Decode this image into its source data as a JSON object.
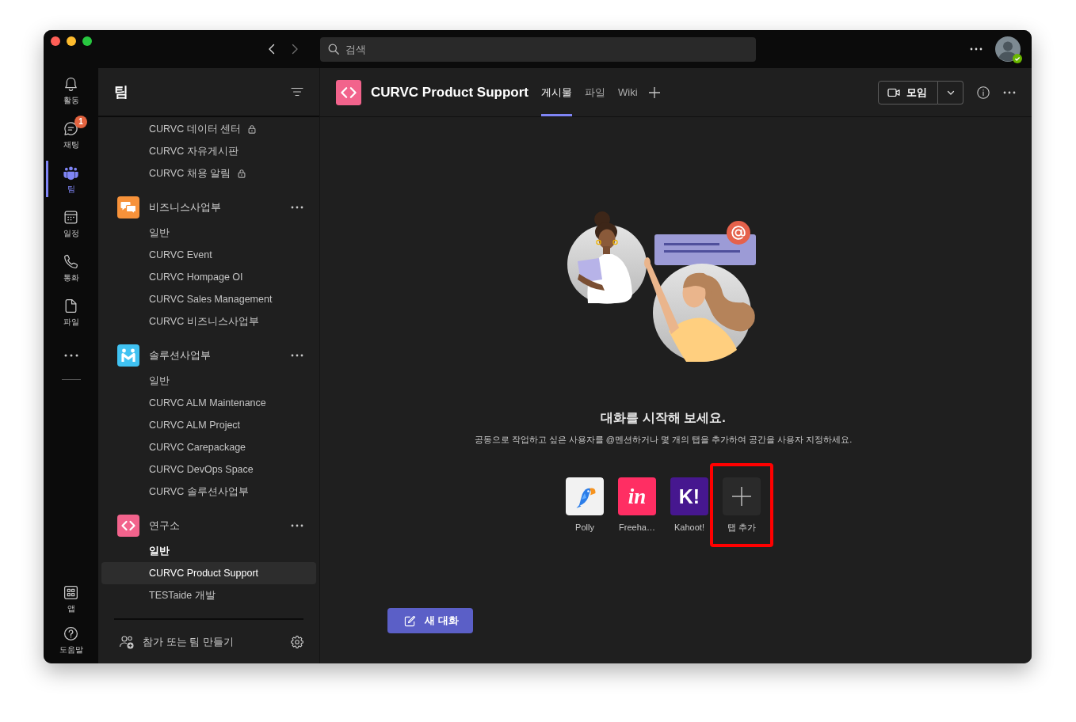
{
  "title_bar": {
    "back": {
      "disabled": false
    },
    "forward": {
      "disabled": true
    },
    "search": {
      "placeholder": "검색"
    }
  },
  "app_bar": {
    "items": [
      {
        "kind": "activity",
        "label": "활동",
        "selected": false
      },
      {
        "kind": "chat",
        "label": "채팅",
        "selected": false,
        "badge": "1"
      },
      {
        "kind": "teams",
        "label": "팀",
        "selected": true
      },
      {
        "kind": "calendar",
        "label": "일정",
        "selected": false
      },
      {
        "kind": "calls",
        "label": "통화",
        "selected": false
      },
      {
        "kind": "files",
        "label": "파일",
        "selected": false
      }
    ],
    "bottom_items": [
      {
        "kind": "apps",
        "label": "앱",
        "selected": false
      },
      {
        "kind": "help",
        "label": "도움말",
        "selected": false
      }
    ]
  },
  "sidebar": {
    "title": "팀",
    "teams": [
      {
        "channels": [
          {
            "label": "CURVC 데이터 센터",
            "locked": true,
            "selected": false,
            "unread": false
          },
          {
            "label": "CURVC 자유게시판",
            "locked": false,
            "selected": false,
            "unread": false
          },
          {
            "label": "CURVC 채용 알림",
            "locked": true,
            "selected": false,
            "unread": false
          }
        ]
      },
      {
        "name": "비즈니스사업부",
        "kind": "chat",
        "color": "#f7923a",
        "channels": [
          {
            "label": "일반",
            "locked": false,
            "selected": false,
            "unread": false
          },
          {
            "label": "CURVC Event",
            "locked": false,
            "selected": false,
            "unread": false
          },
          {
            "label": "CURVC Hompage OI",
            "locked": false,
            "selected": false,
            "unread": false
          },
          {
            "label": "CURVC Sales Management",
            "locked": false,
            "selected": false,
            "unread": false
          },
          {
            "label": "CURVC 비즈니스사업부",
            "locked": false,
            "selected": false,
            "unread": false
          }
        ]
      },
      {
        "name": "솔루션사업부",
        "kind": "people",
        "color": "#40c2f2",
        "channels": [
          {
            "label": "일반",
            "locked": false,
            "selected": false,
            "unread": false
          },
          {
            "label": "CURVC ALM Maintenance",
            "locked": false,
            "selected": false,
            "unread": false
          },
          {
            "label": "CURVC ALM Project",
            "locked": false,
            "selected": false,
            "unread": false
          },
          {
            "label": "CURVC Carepackage",
            "locked": false,
            "selected": false,
            "unread": false
          },
          {
            "label": "CURVC DevOps Space",
            "locked": false,
            "selected": false,
            "unread": false
          },
          {
            "label": "CURVC 솔루션사업부",
            "locked": false,
            "selected": false,
            "unread": false
          }
        ]
      },
      {
        "name": "연구소",
        "kind": "code",
        "color": "#f2638c",
        "channels": [
          {
            "label": "일반",
            "locked": false,
            "selected": false,
            "unread": true
          },
          {
            "label": "CURVC Product Support",
            "locked": false,
            "selected": true,
            "unread": false
          },
          {
            "label": "TESTaide 개발",
            "locked": false,
            "selected": false,
            "unread": false
          }
        ]
      }
    ],
    "footer": {
      "label": "참가 또는 팀 만들기"
    }
  },
  "channel": {
    "title": "CURVC Product Support",
    "tabs": [
      {
        "label": "게시물",
        "selected": true
      },
      {
        "label": "파일",
        "selected": false
      },
      {
        "label": "Wiki",
        "selected": false
      }
    ],
    "meeting_button": {
      "label": "모임"
    }
  },
  "conversation": {
    "heading": "대화를 시작해 보세요.",
    "text": "공동으로 작업하고 싶은 사용자를 @멘션하거나 몇 개의 탭을 추가하여 공간을 사용자 지정하세요.",
    "apps": [
      {
        "kind": "bird",
        "label": "Polly",
        "color": "#f2f2f2",
        "highlighted": false
      },
      {
        "kind": "script",
        "label": "Freeha…",
        "logo": "in",
        "color": "#ff2e63",
        "highlighted": false
      },
      {
        "kind": "letters",
        "label": "Kahoot!",
        "logo": "K!",
        "color": "#46178f",
        "highlighted": false
      },
      {
        "kind": "add",
        "label": "탭 추가",
        "highlighted": true
      }
    ],
    "new_button": {
      "label": "새 대화"
    }
  }
}
